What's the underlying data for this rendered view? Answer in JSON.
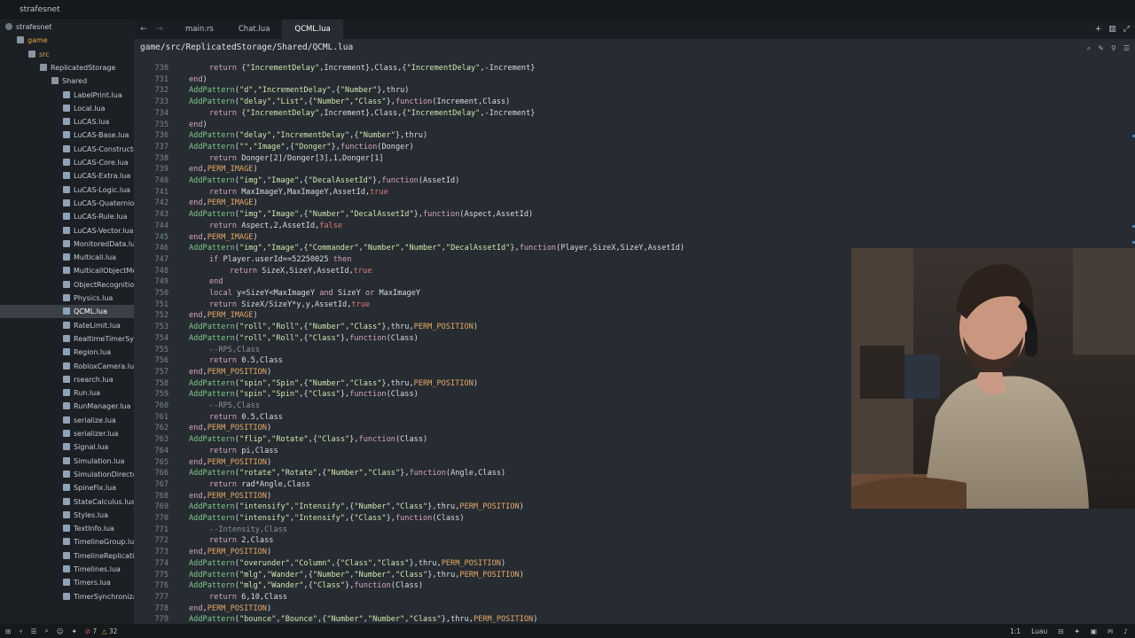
{
  "window": {
    "title": "strafesnet"
  },
  "sidebar": {
    "tree": [
      {
        "label": "strafesnet",
        "kind": "root",
        "indent": 0
      },
      {
        "label": "game",
        "kind": "folder",
        "indent": 1,
        "git_modified": true
      },
      {
        "label": "src",
        "kind": "folder",
        "indent": 2,
        "git_modified": true
      },
      {
        "label": "ReplicatedStorage",
        "kind": "folder",
        "indent": 3
      },
      {
        "label": "Shared",
        "kind": "folder",
        "indent": 4
      },
      {
        "label": "LabelPrint.lua",
        "kind": "file",
        "indent": 5
      },
      {
        "label": "Local.lua",
        "kind": "file",
        "indent": 5
      },
      {
        "label": "LuCAS.lua",
        "kind": "file",
        "indent": 5
      },
      {
        "label": "LuCAS-Base.lua",
        "kind": "file",
        "indent": 5
      },
      {
        "label": "LuCAS-Constructo",
        "kind": "file",
        "indent": 5
      },
      {
        "label": "LuCAS-Core.lua",
        "kind": "file",
        "indent": 5
      },
      {
        "label": "LuCAS-Extra.lua",
        "kind": "file",
        "indent": 5
      },
      {
        "label": "LuCAS-Logic.lua",
        "kind": "file",
        "indent": 5
      },
      {
        "label": "LuCAS-Quaternior",
        "kind": "file",
        "indent": 5
      },
      {
        "label": "LuCAS-Rule.lua",
        "kind": "file",
        "indent": 5
      },
      {
        "label": "LuCAS-Vector.lua",
        "kind": "file",
        "indent": 5
      },
      {
        "label": "MonitoredData.lu",
        "kind": "file",
        "indent": 5
      },
      {
        "label": "Multicall.lua",
        "kind": "file",
        "indent": 5
      },
      {
        "label": "MulticallObjectMe",
        "kind": "file",
        "indent": 5
      },
      {
        "label": "ObjectRecognitior",
        "kind": "file",
        "indent": 5
      },
      {
        "label": "Physics.lua",
        "kind": "file",
        "indent": 5
      },
      {
        "label": "QCML.lua",
        "kind": "file",
        "indent": 5,
        "selected": true
      },
      {
        "label": "RateLimit.lua",
        "kind": "file",
        "indent": 5
      },
      {
        "label": "RealtimeTimerSys",
        "kind": "file",
        "indent": 5
      },
      {
        "label": "Region.lua",
        "kind": "file",
        "indent": 5
      },
      {
        "label": "RobloxCamera.lua",
        "kind": "file",
        "indent": 5
      },
      {
        "label": "rsearch.lua",
        "kind": "file",
        "indent": 5
      },
      {
        "label": "Run.lua",
        "kind": "file",
        "indent": 5
      },
      {
        "label": "RunManager.lua",
        "kind": "file",
        "indent": 5
      },
      {
        "label": "serialize.lua",
        "kind": "file",
        "indent": 5
      },
      {
        "label": "serializer.lua",
        "kind": "file",
        "indent": 5
      },
      {
        "label": "Signal.lua",
        "kind": "file",
        "indent": 5
      },
      {
        "label": "Simulation.lua",
        "kind": "file",
        "indent": 5
      },
      {
        "label": "SimulationDirecto",
        "kind": "file",
        "indent": 5
      },
      {
        "label": "SpineFix.lua",
        "kind": "file",
        "indent": 5
      },
      {
        "label": "StateCalculus.lua",
        "kind": "file",
        "indent": 5
      },
      {
        "label": "Styles.lua",
        "kind": "file",
        "indent": 5
      },
      {
        "label": "TextInfo.lua",
        "kind": "file",
        "indent": 5
      },
      {
        "label": "TimelineGroup.lua",
        "kind": "file",
        "indent": 5
      },
      {
        "label": "TimelineReplicati",
        "kind": "file",
        "indent": 5
      },
      {
        "label": "Timelines.lua",
        "kind": "file",
        "indent": 5
      },
      {
        "label": "Timers.lua",
        "kind": "file",
        "indent": 5
      },
      {
        "label": "TimerSynchroniza",
        "kind": "file",
        "indent": 5
      }
    ]
  },
  "tabs": [
    {
      "label": "main.rs",
      "active": false
    },
    {
      "label": "Chat.lua",
      "active": false
    },
    {
      "label": "QCML.lua",
      "active": true
    }
  ],
  "tab_actions": [
    "+",
    "▥",
    "⤢"
  ],
  "editor": {
    "breadcrumb": "game/src/ReplicatedStorage/Shared/QCML.lua",
    "lines": [
      {
        "n": "730",
        "code": "\t\treturn {\"IncrementDelay\",Increment},Class,{\"IncrementDelay\",-Increment}"
      },
      {
        "n": "731",
        "code": "\tend)"
      },
      {
        "n": "732",
        "code": "\tAddPattern(\"d\",\"IncrementDelay\",{\"Number\"},thru)"
      },
      {
        "n": "733",
        "code": "\tAddPattern(\"delay\",\"List\",{\"Number\",\"Class\"},function(Increment,Class)"
      },
      {
        "n": "734",
        "code": "\t\treturn {\"IncrementDelay\",Increment},Class,{\"IncrementDelay\",-Increment}"
      },
      {
        "n": "735",
        "code": "\tend)"
      },
      {
        "n": "736",
        "code": "\tAddPattern(\"delay\",\"IncrementDelay\",{\"Number\"},thru)"
      },
      {
        "n": "737",
        "code": "\tAddPattern(\"\",\"Image\",{\"Donger\"},function(Donger)"
      },
      {
        "n": "738",
        "code": "\t\treturn Donger[2]/Donger[3],1,Donger[1]"
      },
      {
        "n": "739",
        "code": "\tend,PERM_IMAGE)"
      },
      {
        "n": "740",
        "code": "\tAddPattern(\"img\",\"Image\",{\"DecalAssetId\"},function(AssetId)"
      },
      {
        "n": "741",
        "code": "\t\treturn MaxImageY,MaxImageY,AssetId,true"
      },
      {
        "n": "742",
        "code": "\tend,PERM_IMAGE)"
      },
      {
        "n": "743",
        "code": "\tAddPattern(\"img\",\"Image\",{\"Number\",\"DecalAssetId\"},function(Aspect,AssetId)"
      },
      {
        "n": "744",
        "code": "\t\treturn Aspect,2,AssetId,false"
      },
      {
        "n": "745",
        "code": "\tend,PERM_IMAGE)"
      },
      {
        "n": "746",
        "code": "\tAddPattern(\"img\",\"Image\",{\"Commander\",\"Number\",\"Number\",\"DecalAssetId\"},function(Player,SizeX,SizeY,AssetId)"
      },
      {
        "n": "747",
        "code": "\t\tif Player.userId==52250025 then"
      },
      {
        "n": "748",
        "code": "\t\t\treturn SizeX,SizeY,AssetId,true"
      },
      {
        "n": "749",
        "code": "\t\tend"
      },
      {
        "n": "750",
        "code": "\t\tlocal y=SizeY<MaxImageY and SizeY or MaxImageY"
      },
      {
        "n": "751",
        "code": "\t\treturn SizeX/SizeY*y,y,AssetId,true"
      },
      {
        "n": "752",
        "code": "\tend,PERM_IMAGE)"
      },
      {
        "n": "753",
        "code": "\tAddPattern(\"roll\",\"Roll\",{\"Number\",\"Class\"},thru,PERM_POSITION)"
      },
      {
        "n": "754",
        "code": "\tAddPattern(\"roll\",\"Roll\",{\"Class\"},function(Class)"
      },
      {
        "n": "755",
        "code": "\t\t--RPS,Class"
      },
      {
        "n": "756",
        "code": "\t\treturn 0.5,Class"
      },
      {
        "n": "757",
        "code": "\tend,PERM_POSITION)"
      },
      {
        "n": "758",
        "code": "\tAddPattern(\"spin\",\"Spin\",{\"Number\",\"Class\"},thru,PERM_POSITION)"
      },
      {
        "n": "759",
        "code": "\tAddPattern(\"spin\",\"Spin\",{\"Class\"},function(Class)"
      },
      {
        "n": "760",
        "code": "\t\t--RPS,Class"
      },
      {
        "n": "761",
        "code": "\t\treturn 0.5,Class"
      },
      {
        "n": "762",
        "code": "\tend,PERM_POSITION)"
      },
      {
        "n": "763",
        "code": "\tAddPattern(\"flip\",\"Rotate\",{\"Class\"},function(Class)"
      },
      {
        "n": "764",
        "code": "\t\treturn pi,Class"
      },
      {
        "n": "765",
        "code": "\tend,PERM_POSITION)"
      },
      {
        "n": "766",
        "code": "\tAddPattern(\"rotate\",\"Rotate\",{\"Number\",\"Class\"},function(Angle,Class)"
      },
      {
        "n": "767",
        "code": "\t\treturn rad*Angle,Class"
      },
      {
        "n": "768",
        "code": "\tend,PERM_POSITION)"
      },
      {
        "n": "769",
        "code": "\tAddPattern(\"intensify\",\"Intensify\",{\"Number\",\"Class\"},thru,PERM_POSITION)"
      },
      {
        "n": "770",
        "code": "\tAddPattern(\"intensify\",\"Intensify\",{\"Class\"},function(Class)"
      },
      {
        "n": "771",
        "code": "\t\t--Intensity,Class"
      },
      {
        "n": "772",
        "code": "\t\treturn 2,Class"
      },
      {
        "n": "773",
        "code": "\tend,PERM_POSITION)"
      },
      {
        "n": "774",
        "code": "\tAddPattern(\"overunder\",\"Column\",{\"Class\",\"Class\"},thru,PERM_POSITION)"
      },
      {
        "n": "775",
        "code": "\tAddPattern(\"mlg\",\"Wander\",{\"Number\",\"Number\",\"Class\"},thru,PERM_POSITION)"
      },
      {
        "n": "776",
        "code": "\tAddPattern(\"mlg\",\"Wander\",{\"Class\"},function(Class)"
      },
      {
        "n": "777",
        "code": "\t\treturn 6,10,Class"
      },
      {
        "n": "778",
        "code": "\tend,PERM_POSITION)"
      },
      {
        "n": "779",
        "code": "\tAddPattern(\"bounce\",\"Bounce\",{\"Number\",\"Number\",\"Class\"},thru,PERM_POSITION)"
      }
    ]
  },
  "statusbar": {
    "errors": "7",
    "warnings": "32",
    "cursor": "1:1",
    "language": "Luau"
  },
  "colors": {
    "editor_bg": "#262c31",
    "function_name": "#7fc98c",
    "string": "#cfe7b0",
    "keyword": "#d8a2c7",
    "permission_const": "#e7a867",
    "boolean": "#e07a7a"
  }
}
